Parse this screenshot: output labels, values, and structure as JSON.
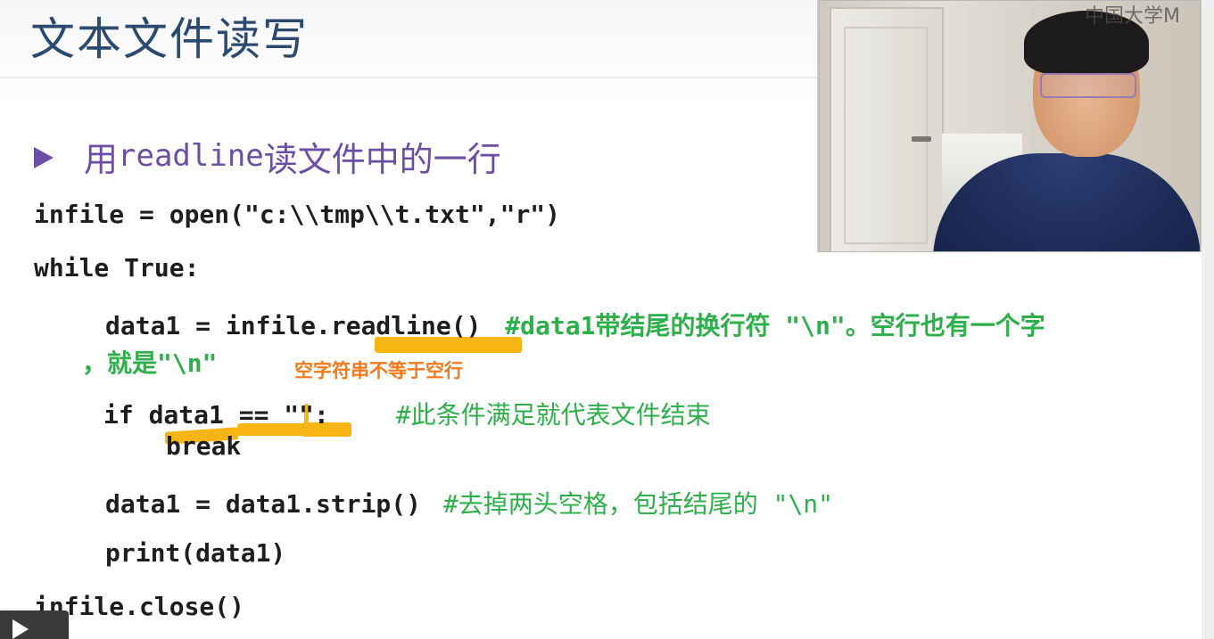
{
  "slide": {
    "title": "文本文件读写",
    "bullet": {
      "prefix": "用",
      "keyword": "readline",
      "suffix": "读文件中的一行"
    },
    "code_lines": {
      "line1": "infile = open(\"c:\\\\tmp\\\\t.txt\",\"r\")",
      "line2": "while True:",
      "line3_code": "data1 = infile.readline()",
      "line3_comment": "#data1带结尾的换行符 \"\\n\"。空行也有一个字",
      "line3_cont": "，就是\"\\n\"",
      "line4_code": "if data1 == \"\":",
      "line4_comment": "#此条件满足就代表文件结束",
      "line5": "break",
      "line6_code": "data1 = data1.strip()",
      "line6_comment": "#去掉两头空格，包括结尾的 \"\\n\"",
      "line7": "print(data1)",
      "line8": "infile.close()"
    },
    "annotation": "空字符串不等于空行",
    "colors": {
      "title": "#2b4a6e",
      "bullet": "#6b4fa3",
      "comment": "#2fae4c",
      "highlight": "#f7b513",
      "annotation": "#f2791c"
    }
  },
  "webcam": {
    "watermark": "中国大学M"
  },
  "player": {
    "play_icon": "play-icon"
  }
}
